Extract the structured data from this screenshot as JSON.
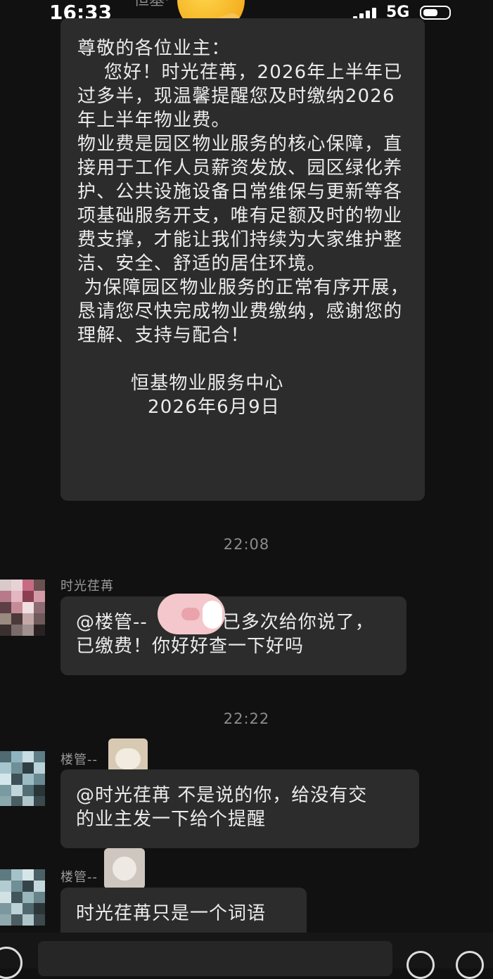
{
  "status": {
    "time": "16:33",
    "network": "5G"
  },
  "header": {
    "title": "恒基·"
  },
  "notice": {
    "paragraphs": [
      "尊敬的各位业主：",
      "    您好！时光荏苒，2026年上半年已过多半，现温馨提醒您及时缴纳2026年上半年物业费。",
      "物业费是园区物业服务的核心保障，直接用于工作人员薪资发放、园区绿化养护、公共设施设备日常维保与更新等各项基础服务开支，唯有足额及时的物业费支撑，才能让我们持续为大家维护整洁、安全、舒适的居住环境。",
      " 为保障园区物业服务的正常有序开展，恳请您尽快完成物业费缴纳，感谢您的理解、支持与配合！"
    ],
    "signature": "恒基物业服务中心",
    "date": "2026年6月9日"
  },
  "timestamps": [
    "22:08",
    "22:22"
  ],
  "messages": [
    {
      "sender": "时光荏苒",
      "line1_before": "@楼管--",
      "line1_after": "已多次给你说了，",
      "line2": "已缴费！你好好查一下好吗"
    },
    {
      "sender": "楼管--",
      "line1": "@时光荏苒 不是说的你，给没有交",
      "line2": "的业主发一下给个提醒"
    },
    {
      "sender": "楼管--",
      "line1": "时光荏苒只是一个词语"
    }
  ],
  "colors": {
    "background": "#111111",
    "bubble": "#2c2c2c",
    "text": "#ececec",
    "meta": "#8c8c8c"
  }
}
